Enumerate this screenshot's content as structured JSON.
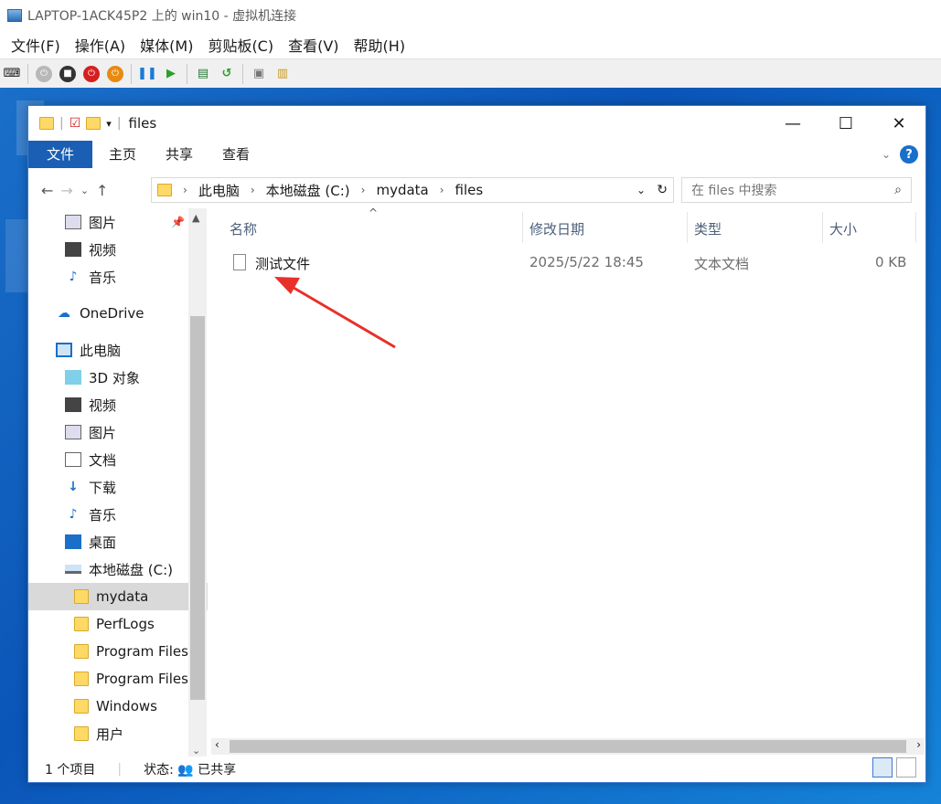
{
  "host": {
    "title": "LAPTOP-1ACK45P2 上的 win10 - 虚拟机连接",
    "menu": [
      "文件(F)",
      "操作(A)",
      "媒体(M)",
      "剪贴板(C)",
      "查看(V)",
      "帮助(H)"
    ]
  },
  "explorer": {
    "title": "files",
    "ribbon_tabs": [
      "文件",
      "主页",
      "共享",
      "查看"
    ],
    "breadcrumbs": [
      "此电脑",
      "本地磁盘 (C:)",
      "mydata",
      "files"
    ],
    "search_placeholder": "在 files 中搜索",
    "nav": [
      {
        "label": "图片",
        "icon": "pictures-icon",
        "pinned": true
      },
      {
        "label": "视频",
        "icon": "video-icon"
      },
      {
        "label": "音乐",
        "icon": "music-icon"
      },
      {
        "label": "OneDrive",
        "icon": "onedrive-icon"
      },
      {
        "label": "此电脑",
        "icon": "this-pc-icon"
      },
      {
        "label": "3D 对象",
        "icon": "3d-objects-icon"
      },
      {
        "label": "视频",
        "icon": "video-icon"
      },
      {
        "label": "图片",
        "icon": "pictures-icon"
      },
      {
        "label": "文档",
        "icon": "documents-icon"
      },
      {
        "label": "下载",
        "icon": "download-icon"
      },
      {
        "label": "音乐",
        "icon": "music-icon"
      },
      {
        "label": "桌面",
        "icon": "desktop-icon"
      },
      {
        "label": "本地磁盘 (C:)",
        "icon": "drive-icon"
      },
      {
        "label": "mydata",
        "icon": "folder-icon",
        "selected": true
      },
      {
        "label": "PerfLogs",
        "icon": "folder-icon"
      },
      {
        "label": "Program Files",
        "icon": "folder-icon"
      },
      {
        "label": "Program Files",
        "icon": "folder-icon"
      },
      {
        "label": "Windows",
        "icon": "folder-icon"
      },
      {
        "label": "用户",
        "icon": "folder-icon"
      }
    ],
    "columns": [
      "名称",
      "修改日期",
      "类型",
      "大小"
    ],
    "files": [
      {
        "name": "测试文件",
        "modified": "2025/5/22 18:45",
        "type": "文本文档",
        "size": "0 KB"
      }
    ],
    "status": {
      "count": "1 个项目",
      "state_label": "状态:",
      "state_value": "已共享"
    }
  },
  "colors": {
    "accent": "#1a5fb4",
    "arrow": "#e8302a",
    "folder": "#ffd966"
  }
}
